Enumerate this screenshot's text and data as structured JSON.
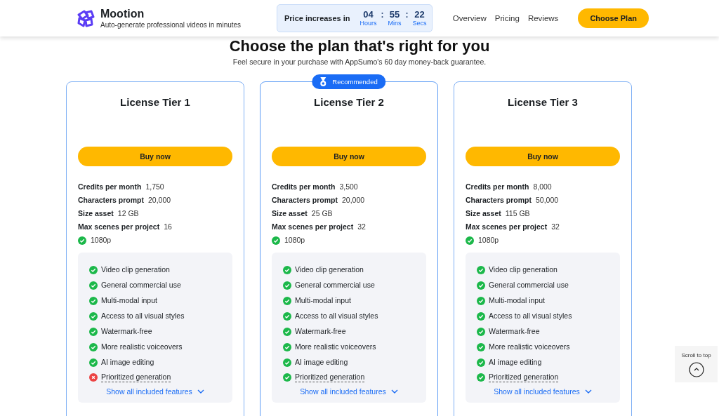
{
  "header": {
    "brand": "Mootion",
    "tagline": "Auto-generate professional videos in minutes",
    "countdown": {
      "label": "Price increases in",
      "units": [
        {
          "value": "04",
          "unit": "Hours"
        },
        {
          "value": "55",
          "unit": "Mins"
        },
        {
          "value": "22",
          "unit": "Secs"
        }
      ],
      "separator": ":"
    },
    "nav": [
      "Overview",
      "Pricing",
      "Reviews"
    ],
    "cta": "Choose Plan"
  },
  "heading": "Choose the plan that's right for you",
  "subheading": "Feel secure in your purchase with AppSumo's 60 day money-back guarantee.",
  "plans": [
    {
      "title": "License Tier 1",
      "recommended": false,
      "button": "Buy now",
      "specs": [
        {
          "label": "Credits per month",
          "value": "1,750"
        },
        {
          "label": "Characters prompt",
          "value": "20,000"
        },
        {
          "label": "Size asset",
          "value": "12 GB"
        },
        {
          "label": "Max scenes per project",
          "value": "16"
        }
      ],
      "resolution": "1080p",
      "features": [
        {
          "text": "Video clip generation",
          "included": true
        },
        {
          "text": "General commercial use",
          "included": true
        },
        {
          "text": "Multi-modal input",
          "included": true
        },
        {
          "text": "Access to all visual styles",
          "included": true
        },
        {
          "text": "Watermark-free",
          "included": true
        },
        {
          "text": "More realistic voiceovers",
          "included": true
        },
        {
          "text": "AI image editing",
          "included": true
        },
        {
          "text": "Prioritized generation",
          "included": false,
          "dotted_underline": true
        }
      ],
      "show_all": "Show all included features"
    },
    {
      "title": "License Tier 2",
      "recommended": true,
      "badge": "Recommended",
      "button": "Buy now",
      "specs": [
        {
          "label": "Credits per month",
          "value": "3,500"
        },
        {
          "label": "Characters prompt",
          "value": "20,000"
        },
        {
          "label": "Size asset",
          "value": "25 GB"
        },
        {
          "label": "Max scenes per project",
          "value": "32"
        }
      ],
      "resolution": "1080p",
      "features": [
        {
          "text": "Video clip generation",
          "included": true
        },
        {
          "text": "General commercial use",
          "included": true
        },
        {
          "text": "Multi-modal input",
          "included": true
        },
        {
          "text": "Access to all visual styles",
          "included": true
        },
        {
          "text": "Watermark-free",
          "included": true
        },
        {
          "text": "More realistic voiceovers",
          "included": true
        },
        {
          "text": "AI image editing",
          "included": true
        },
        {
          "text": "Prioritized generation",
          "included": true,
          "dotted_underline": true
        }
      ],
      "show_all": "Show all included features"
    },
    {
      "title": "License Tier 3",
      "recommended": false,
      "button": "Buy now",
      "specs": [
        {
          "label": "Credits per month",
          "value": "8,000"
        },
        {
          "label": "Characters prompt",
          "value": "50,000"
        },
        {
          "label": "Size asset",
          "value": "115 GB"
        },
        {
          "label": "Max scenes per project",
          "value": "32"
        }
      ],
      "resolution": "1080p",
      "features": [
        {
          "text": "Video clip generation",
          "included": true
        },
        {
          "text": "General commercial use",
          "included": true
        },
        {
          "text": "Multi-modal input",
          "included": true
        },
        {
          "text": "Access to all visual styles",
          "included": true
        },
        {
          "text": "Watermark-free",
          "included": true
        },
        {
          "text": "More realistic voiceovers",
          "included": true
        },
        {
          "text": "AI image editing",
          "included": true
        },
        {
          "text": "Prioritized generation",
          "included": true,
          "dotted_underline": true
        }
      ],
      "show_all": "Show all included features"
    }
  ],
  "scroll_to_top": "Scroll to top"
}
